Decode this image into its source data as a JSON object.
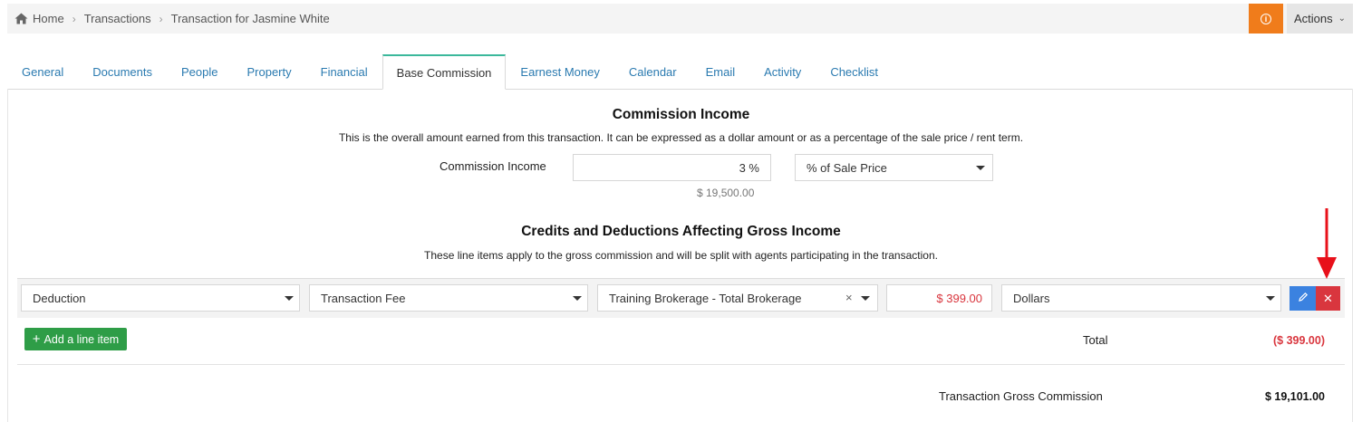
{
  "breadcrumb": {
    "home": "Home",
    "transactions": "Transactions",
    "current": "Transaction for Jasmine White"
  },
  "header": {
    "info_icon": "info-icon",
    "actions_label": "Actions"
  },
  "tabs": [
    {
      "label": "General",
      "active": false
    },
    {
      "label": "Documents",
      "active": false
    },
    {
      "label": "People",
      "active": false
    },
    {
      "label": "Property",
      "active": false
    },
    {
      "label": "Financial",
      "active": false
    },
    {
      "label": "Base Commission",
      "active": true
    },
    {
      "label": "Earnest Money",
      "active": false
    },
    {
      "label": "Calendar",
      "active": false
    },
    {
      "label": "Email",
      "active": false
    },
    {
      "label": "Activity",
      "active": false
    },
    {
      "label": "Checklist",
      "active": false
    }
  ],
  "commission": {
    "title": "Commission Income",
    "description": "This is the overall amount earned from this transaction. It can be expressed as a dollar amount or as a percentage of the sale price / rent term.",
    "label": "Commission Income",
    "value": "3 %",
    "basis": "% of Sale Price",
    "computed_amount": "$ 19,500.00"
  },
  "credits": {
    "title": "Credits and Deductions Affecting Gross Income",
    "description": "These line items apply to the gross commission and will be split with agents participating in the transaction.",
    "line_item": {
      "type": "Deduction",
      "category": "Transaction Fee",
      "payee": "Training Brokerage - Total Brokerage",
      "clear_symbol": "×",
      "amount": "$ 399.00",
      "unit": "Dollars"
    },
    "add_label": "Add a line item",
    "total_label": "Total",
    "total_value": "($ 399.00)"
  },
  "gross": {
    "label": "Transaction Gross Commission",
    "value": "$ 19,101.00"
  },
  "colors": {
    "accent_tab": "#3bb89b",
    "link": "#2a7ab0",
    "warning_button": "#f07c1b",
    "edit_button": "#3b82e0",
    "delete_button": "#d9363e",
    "add_button": "#2e9d47",
    "annotation_arrow": "#e8101a"
  }
}
